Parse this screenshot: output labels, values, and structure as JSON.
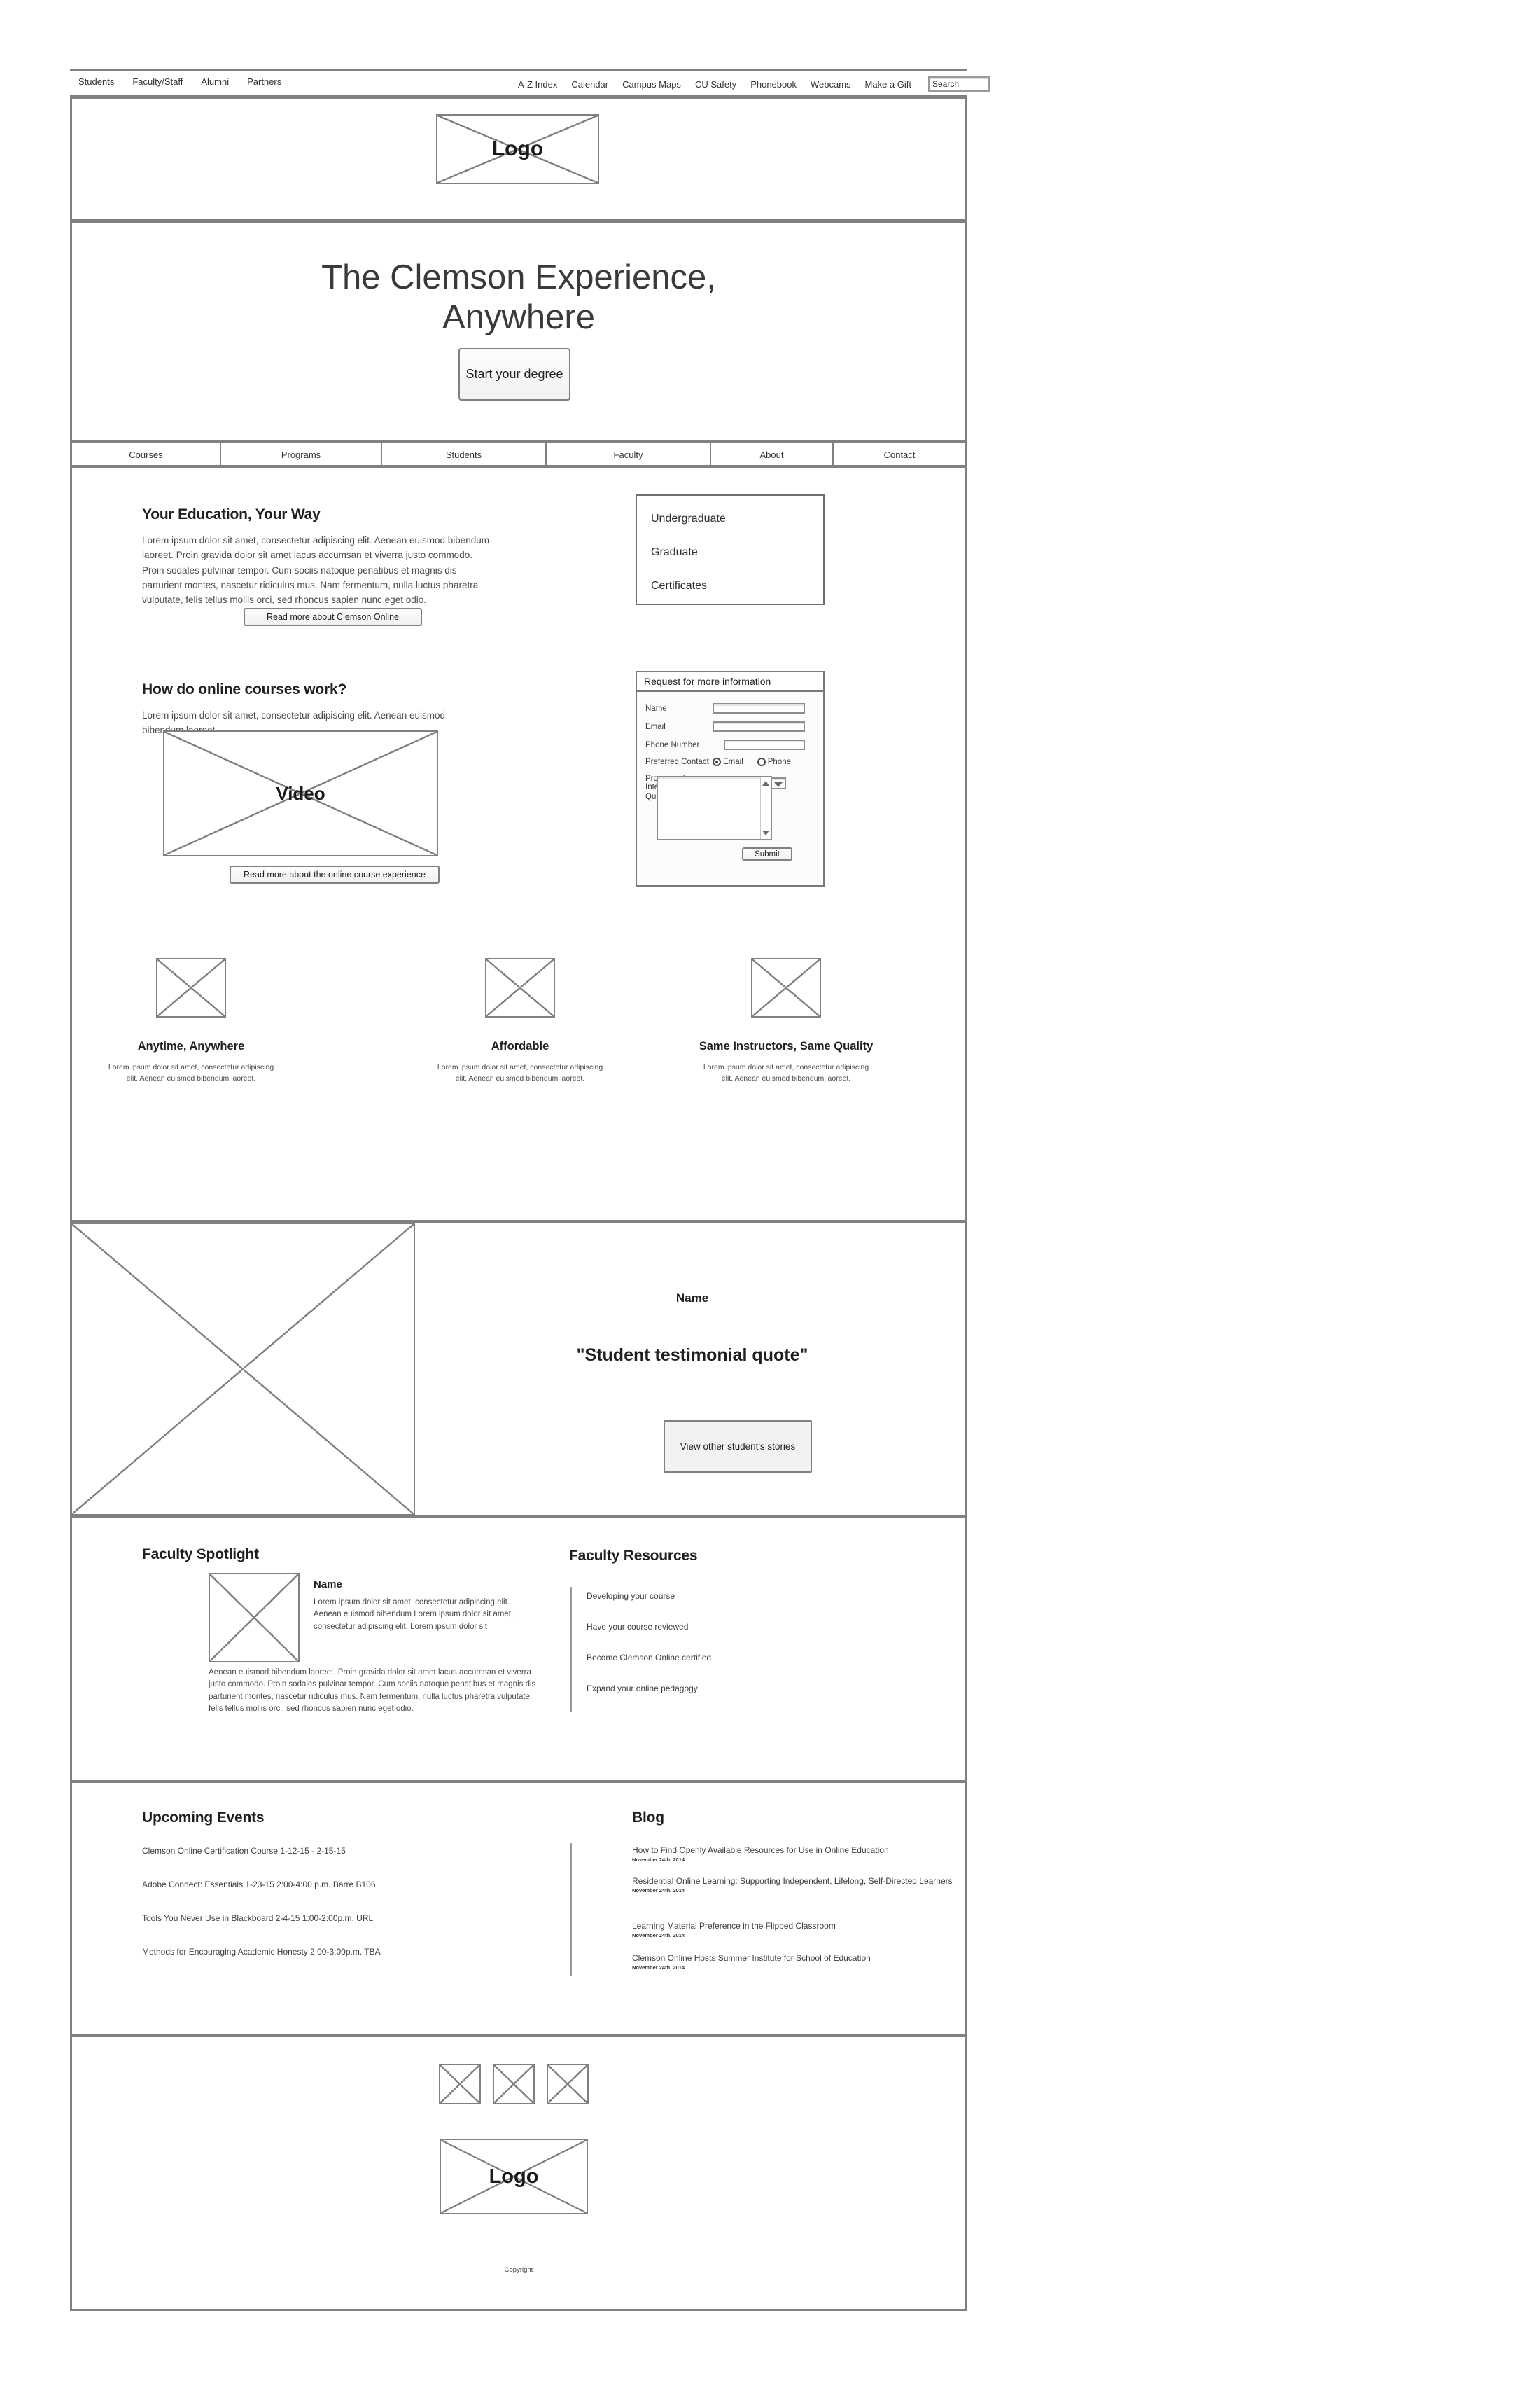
{
  "utility_nav": {
    "audience_links": [
      "Students",
      "Faculty/Staff",
      "Alumni",
      "Partners"
    ],
    "resource_links": [
      "A-Z Index",
      "Calendar",
      "Campus Maps",
      "CU Safety",
      "Phonebook",
      "Webcams",
      "Make a Gift"
    ],
    "search_value": "Search"
  },
  "header": {
    "logo_label": "Logo"
  },
  "hero": {
    "title_line1": "The Clemson Experience,",
    "title_line2": "Anywhere",
    "cta_label": "Start your degree"
  },
  "main_nav": {
    "tabs": [
      "Courses",
      "Programs",
      "Students",
      "Faculty",
      "About",
      "Contact"
    ]
  },
  "education": {
    "heading": "Your Education, Your Way",
    "body": "Lorem ipsum dolor sit amet, consectetur adipiscing elit. Aenean euismod bibendum laoreet. Proin gravida dolor sit amet lacus accumsan et viverra justo commodo. Proin sodales pulvinar tempor. Cum sociis natoque penatibus et magnis dis parturient montes, nascetur ridiculus mus. Nam fermentum, nulla luctus pharetra vulputate, felis tellus mollis orci, sed rhoncus sapien nunc eget odio.",
    "read_more_label": "Read more about Clemson Online"
  },
  "program_levels": {
    "items": [
      "Undergraduate",
      "Graduate",
      "Certificates"
    ]
  },
  "courses_work": {
    "heading": "How do online courses work?",
    "body": "Lorem ipsum dolor sit amet, consectetur adipiscing elit. Aenean euismod bibendum laoreet.",
    "video_label": "Video",
    "read_more_label": "Read more about the online course experience"
  },
  "rfi_form": {
    "title": "Request for more information",
    "name_label": "Name",
    "email_label": "Email",
    "phone_label": "Phone Number",
    "preferred_contact_label": "Preferred Contact",
    "radio_email_label": "Email",
    "radio_phone_label": "Phone",
    "program_label": "Program of Interest",
    "questions_label": "Questions",
    "submit_label": "Submit"
  },
  "features": [
    {
      "title": "Anytime, Anywhere",
      "description": "Lorem ipsum dolor sit amet, consectetur adipiscing elit. Aenean euismod bibendum laoreet."
    },
    {
      "title": "Affordable",
      "description": "Lorem ipsum dolor sit amet, consectetur adipiscing elit. Aenean euismod bibendum laoreet."
    },
    {
      "title": "Same Instructors, Same Quality",
      "description": "Lorem ipsum dolor sit amet, consectetur adipiscing elit. Aenean euismod bibendum laoreet."
    }
  ],
  "testimonial": {
    "name": "Name",
    "quote": "\"Student testimonial quote\"",
    "cta_label": "View other student's stories"
  },
  "faculty_spotlight": {
    "heading": "Faculty Spotlight",
    "name": "Name",
    "lead": "Lorem ipsum dolor sit amet, consectetur adipiscing elit. Aenean euismod bibendum Lorem ipsum dolor sit amet, consectetur adipiscing elit. Lorem ipsum dolor sit",
    "body": "Aenean euismod bibendum laoreet. Proin gravida dolor sit amet lacus accumsan et viverra justo commodo. Proin sodales pulvinar tempor. Cum sociis natoque penatibus et magnis dis parturient montes, nascetur ridiculus mus. Nam fermentum, nulla luctus pharetra vulputate, felis tellus mollis orci, sed rhoncus sapien nunc eget odio."
  },
  "faculty_resources": {
    "heading": "Faculty Resources",
    "items": [
      "Developing your course",
      "Have your course reviewed",
      "Become Clemson Online certified",
      "Expand your online pedagogy"
    ]
  },
  "upcoming_events": {
    "heading": "Upcoming Events",
    "items": [
      "Clemson Online Certification Course   1-12-15 - 2-15-15",
      "Adobe Connect: Essentials  1-23-15   2:00-4:00 p.m. Barre B106",
      "Tools You Never Use in Blackboard 2-4-15 1:00-2:00p.m. URL",
      "Methods for Encouraging Academic Honesty 2:00-3:00p.m. TBA"
    ]
  },
  "blog": {
    "heading": "Blog",
    "posts": [
      {
        "title": "How to Find Openly Available Resources for Use in Online Education",
        "date": "November 24th, 2014"
      },
      {
        "title": "Residential Online Learning: Supporting Independent, Lifelong, Self-Directed Learners",
        "date": "November 24th, 2014"
      },
      {
        "title": "Learning Material Preference in the Flipped Classroom",
        "date": "November 24th, 2014"
      },
      {
        "title": "Clemson Online Hosts Summer Institute for School of Education",
        "date": "November 24th, 2014"
      }
    ]
  },
  "footer": {
    "social_icons": [
      "social-icon-1",
      "social-icon-2",
      "social-icon-3"
    ],
    "logo_label": "Logo",
    "copyright": "Copyright"
  }
}
